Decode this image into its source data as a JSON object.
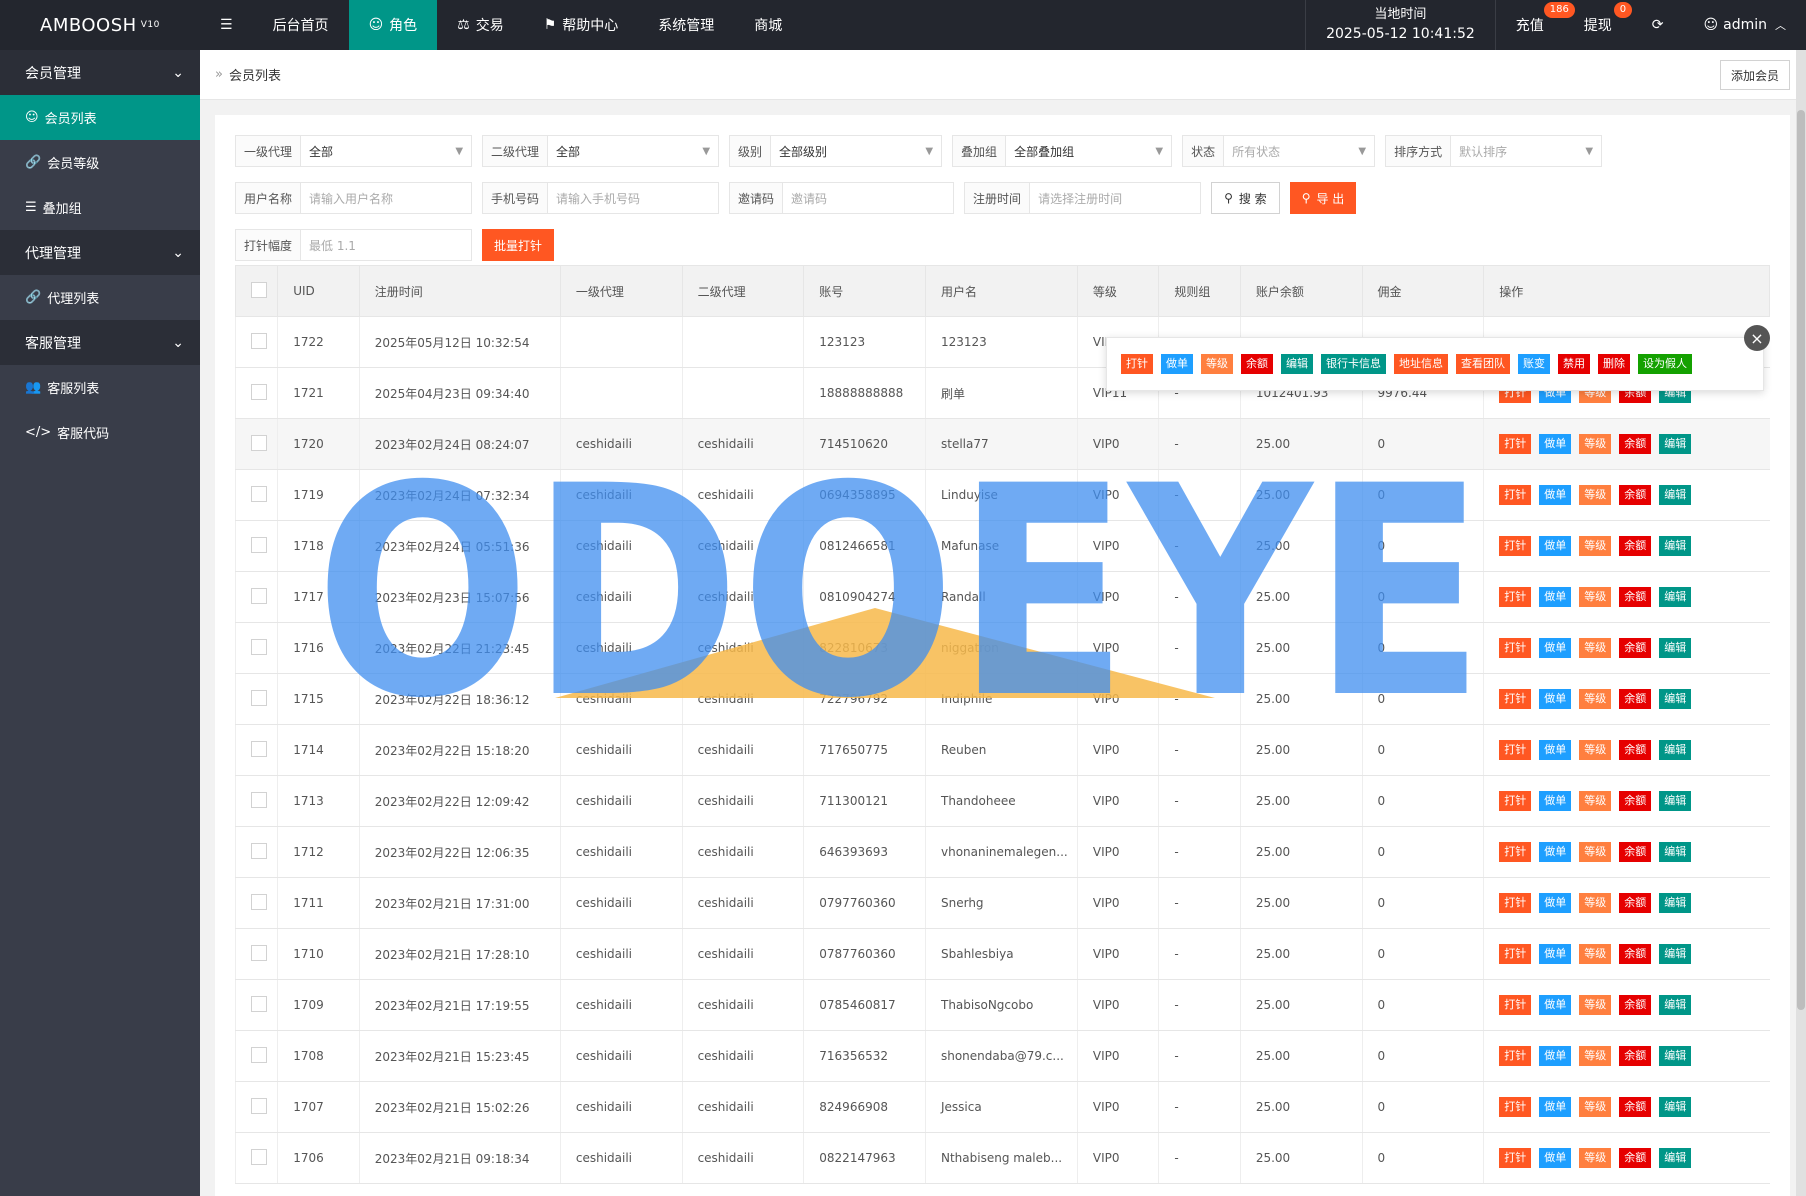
{
  "app": {
    "logo": "AMBOOSH",
    "version": "V10"
  },
  "topnav": [
    {
      "label": "后台首页",
      "icon": ""
    },
    {
      "label": "角色",
      "icon": "user-icon",
      "active": true
    },
    {
      "label": "交易",
      "icon": "scale-icon"
    },
    {
      "label": "帮助中心",
      "icon": "flag-icon"
    },
    {
      "label": "系统管理",
      "icon": ""
    },
    {
      "label": "商城",
      "icon": ""
    }
  ],
  "header": {
    "time_label": "当地时间",
    "time_value": "2025-05-12 10:41:52",
    "recharge": "充值",
    "recharge_badge": "186",
    "withdraw": "提现",
    "withdraw_badge": "0",
    "user": "admin"
  },
  "sidebar": {
    "g1": "会员管理",
    "g1_items": [
      "会员列表",
      "会员等级",
      "叠加组"
    ],
    "g2": "代理管理",
    "g2_items": [
      "代理列表"
    ],
    "g3": "客服管理",
    "g3_items": [
      "客服列表",
      "客服代码"
    ]
  },
  "breadcrumb": "会员列表",
  "add_button": "添加会员",
  "filters": {
    "row1": [
      {
        "label": "一级代理",
        "value": "全部",
        "placeholder": false
      },
      {
        "label": "二级代理",
        "value": "全部",
        "placeholder": false
      },
      {
        "label": "级别",
        "value": "全部级别",
        "placeholder": false
      },
      {
        "label": "叠加组",
        "value": "全部叠加组",
        "placeholder": false
      },
      {
        "label": "状态",
        "value": "所有状态",
        "placeholder": true
      },
      {
        "label": "排序方式",
        "value": "默认排序",
        "placeholder": true
      }
    ],
    "row2": [
      {
        "label": "用户名称",
        "value": "请输入用户名称"
      },
      {
        "label": "手机号码",
        "value": "请输入手机号码"
      },
      {
        "label": "邀请码",
        "value": "邀请码"
      },
      {
        "label": "注册时间",
        "value": "请选择注册时间"
      }
    ],
    "search": "搜 索",
    "export": "导 出",
    "needle_label": "打针幅度",
    "needle_placeholder": "最低 1.1",
    "batch": "批量打针"
  },
  "table": {
    "headers": [
      "UID",
      "注册时间",
      "一级代理",
      "二级代理",
      "账号",
      "用户名",
      "等级",
      "规则组",
      "账户余额",
      "佣金",
      "操作"
    ],
    "rows": [
      [
        "1722",
        "2025年05月12日 10:32:54",
        "",
        "",
        "123123",
        "123123",
        "VIP",
        "",
        "",
        "",
        ""
      ],
      [
        "1721",
        "2025年04月23日 09:34:40",
        "",
        "",
        "18888888888",
        "刷单",
        "VIP11",
        "-",
        "1012401.93",
        "9976.44",
        ""
      ],
      [
        "1720",
        "2023年02月24日 08:24:07",
        "ceshidaili",
        "ceshidaili",
        "714510620",
        "stella77",
        "VIP0",
        "-",
        "25.00",
        "0",
        ""
      ],
      [
        "1719",
        "2023年02月24日 07:32:34",
        "ceshidaili",
        "ceshidaili",
        "0694358895",
        "Linduyise",
        "VIP0",
        "-",
        "25.00",
        "0",
        ""
      ],
      [
        "1718",
        "2023年02月24日 05:51:36",
        "ceshidaili",
        "ceshidaili",
        "0812466581",
        "Mafunase",
        "VIP0",
        "-",
        "25.00",
        "0",
        ""
      ],
      [
        "1717",
        "2023年02月23日 15:07:56",
        "ceshidaili",
        "ceshidaili",
        "0810904274",
        "Randall",
        "VIP0",
        "-",
        "25.00",
        "0",
        ""
      ],
      [
        "1716",
        "2023年02月22日 21:23:45",
        "ceshidaili",
        "ceshidaili",
        "822810673",
        "niggatron",
        "VIP0",
        "-",
        "25.00",
        "0",
        ""
      ],
      [
        "1715",
        "2023年02月22日 18:36:12",
        "ceshidaili",
        "ceshidaili",
        "722796792",
        "Indiphile",
        "VIP0",
        "-",
        "25.00",
        "0",
        ""
      ],
      [
        "1714",
        "2023年02月22日 15:18:20",
        "ceshidaili",
        "ceshidaili",
        "717650775",
        "Reuben",
        "VIP0",
        "-",
        "25.00",
        "0",
        ""
      ],
      [
        "1713",
        "2023年02月22日 12:09:42",
        "ceshidaili",
        "ceshidaili",
        "711300121",
        "Thandoheee",
        "VIP0",
        "-",
        "25.00",
        "0",
        ""
      ],
      [
        "1712",
        "2023年02月22日 12:06:35",
        "ceshidaili",
        "ceshidaili",
        "646393693",
        "vhonaninemalegen...",
        "VIP0",
        "-",
        "25.00",
        "0",
        ""
      ],
      [
        "1711",
        "2023年02月21日 17:31:00",
        "ceshidaili",
        "ceshidaili",
        "0797760360",
        "Snerhg",
        "VIP0",
        "-",
        "25.00",
        "0",
        ""
      ],
      [
        "1710",
        "2023年02月21日 17:28:10",
        "ceshidaili",
        "ceshidaili",
        "0787760360",
        "Sbahlesbiya",
        "VIP0",
        "-",
        "25.00",
        "0",
        ""
      ],
      [
        "1709",
        "2023年02月21日 17:19:55",
        "ceshidaili",
        "ceshidaili",
        "0785460817",
        "ThabisoNgcobo",
        "VIP0",
        "-",
        "25.00",
        "0",
        ""
      ],
      [
        "1708",
        "2023年02月21日 15:23:45",
        "ceshidaili",
        "ceshidaili",
        "716356532",
        "shonendaba@79.c...",
        "VIP0",
        "-",
        "25.00",
        "0",
        ""
      ],
      [
        "1707",
        "2023年02月21日 15:02:26",
        "ceshidaili",
        "ceshidaili",
        "824966908",
        "Jessica",
        "VIP0",
        "-",
        "25.00",
        "0",
        ""
      ],
      [
        "1706",
        "2023年02月21日 09:18:34",
        "ceshidaili",
        "ceshidaili",
        "0822147963",
        "Nthabiseng maleb...",
        "VIP0",
        "-",
        "25.00",
        "0",
        ""
      ]
    ],
    "row_ops": [
      "打针",
      "做单",
      "等级",
      "余额",
      "编辑"
    ]
  },
  "popup_ops": [
    "打针",
    "做单",
    "等级",
    "余额",
    "编辑",
    "银行卡信息",
    "地址信息",
    "查看团队",
    "账变",
    "禁用",
    "删除",
    "设为假人"
  ],
  "watermark": "ODOEYE"
}
